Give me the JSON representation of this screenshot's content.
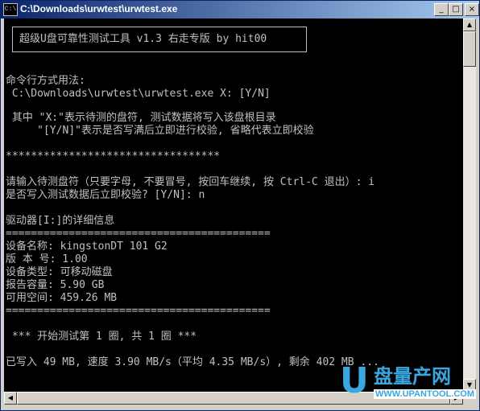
{
  "window": {
    "title": "C:\\Downloads\\urwtest\\urwtest.exe",
    "icon_text": "C:\\",
    "minimize_label": "_",
    "maximize_label": "□",
    "close_label": "×"
  },
  "console": {
    "banner": "超级U盘可靠性测试工具 v1.3 右走专版 by hit00",
    "lines": {
      "usage_header": "命令行方式用法:",
      "usage_cmd": " C:\\Downloads\\urwtest\\urwtest.exe X: [Y/N]",
      "explain_1": " 其中 \"X:\"表示待测的盘符, 测试数据将写入该盘根目录",
      "explain_2": "     \"[Y/N]\"表示是否写满后立即进行校验, 省略代表立即校验",
      "stars": "**********************************",
      "prompt_drive": "请输入待测盘符（只要字母, 不要冒号, 按回车继续, 按 Ctrl-C 退出）: i",
      "prompt_verify": "是否写入测试数据后立即校验? [Y/N]: n",
      "drive_info": "驱动器[I:]的详细信息",
      "sep_1": "==========================================",
      "device_name": "设备名称: kingstonDT 101 G2",
      "version": "版 本 号: 1.00",
      "device_type": "设备类型: 可移动磁盘",
      "capacity": "报告容量: 5.90 GB",
      "free_space": "可用空间: 459.26 MB",
      "sep_2": "==========================================",
      "round": " *** 开始测试第 1 圈, 共 1 圈 ***",
      "progress": "已写入 49 MB, 速度 3.90 MB/s（平均 4.35 MB/s）, 剩余 402 MB ..."
    }
  },
  "scrollbar": {
    "up_arrow": "▲",
    "down_arrow": "▼",
    "left_arrow": "◀",
    "right_arrow": "▶"
  },
  "watermark": {
    "letter": "U",
    "name": "盘量产网",
    "url": "WWW.UPANTOOL.COM"
  }
}
